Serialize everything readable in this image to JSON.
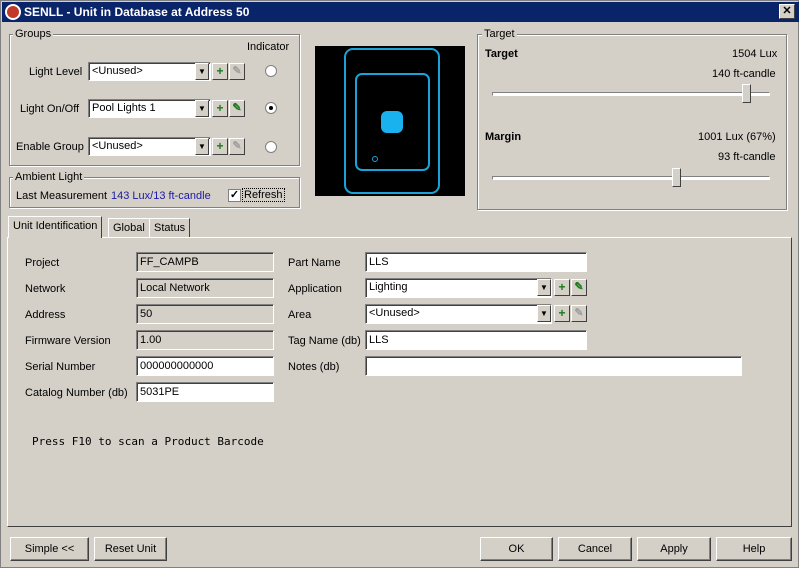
{
  "window": {
    "title": "SENLL - Unit in Database at Address 50",
    "close_label": "✕"
  },
  "groups": {
    "legend": "Groups",
    "indicator_label": "Indicator",
    "rows": [
      {
        "label": "Light Level",
        "value": "<Unused>",
        "indicator": false
      },
      {
        "label": "Light On/Off",
        "value": "Pool Lights 1",
        "indicator": true
      },
      {
        "label": "Enable Group",
        "value": "<Unused>",
        "indicator": false
      }
    ]
  },
  "ambient": {
    "legend": "Ambient Light",
    "last_label": "Last Measurement",
    "last_value": "143 Lux/13 ft-candle",
    "refresh_label": "Refresh",
    "refresh_checked": true
  },
  "target": {
    "legend": "Target",
    "target_label": "Target",
    "target_lux": "1504 Lux",
    "target_fc": "140 ft-candle",
    "target_slider_fraction": 0.93,
    "margin_label": "Margin",
    "margin_lux": "1001 Lux (67%)",
    "margin_fc": "93 ft-candle",
    "margin_slider_fraction": 0.67
  },
  "tabs": [
    {
      "label": "Unit Identification",
      "active": true
    },
    {
      "label": "Global",
      "active": false
    },
    {
      "label": "Status",
      "active": false
    }
  ],
  "ident": {
    "project_label": "Project",
    "project": "FF_CAMPB",
    "network_label": "Network",
    "network": "Local Network",
    "address_label": "Address",
    "address": "50",
    "firmware_label": "Firmware Version",
    "firmware": "1.00",
    "serial_label": "Serial Number",
    "serial": "000000000000",
    "catalog_label": "Catalog Number (db)",
    "catalog": "5031PE",
    "part_label": "Part Name",
    "part": "LLS",
    "application_label": "Application",
    "application": "Lighting",
    "area_label": "Area",
    "area": "<Unused>",
    "tag_label": "Tag Name (db)",
    "tag": "LLS",
    "notes_label": "Notes (db)",
    "notes": "",
    "hint": "Press F10 to scan a Product Barcode"
  },
  "buttons": {
    "simple": "Simple <<",
    "reset": "Reset Unit",
    "ok": "OK",
    "cancel": "Cancel",
    "apply": "Apply",
    "help": "Help"
  },
  "icons": {
    "dropdown": "chevron-down-icon",
    "add": "plus-icon",
    "edit": "pencil-icon"
  },
  "colors": {
    "title_bar": "#0a246a",
    "preview_bg": "#000000",
    "preview_outline": "#1aa3d9",
    "led": "#1ab2ee",
    "measurement_text": "#1a1aa6"
  }
}
